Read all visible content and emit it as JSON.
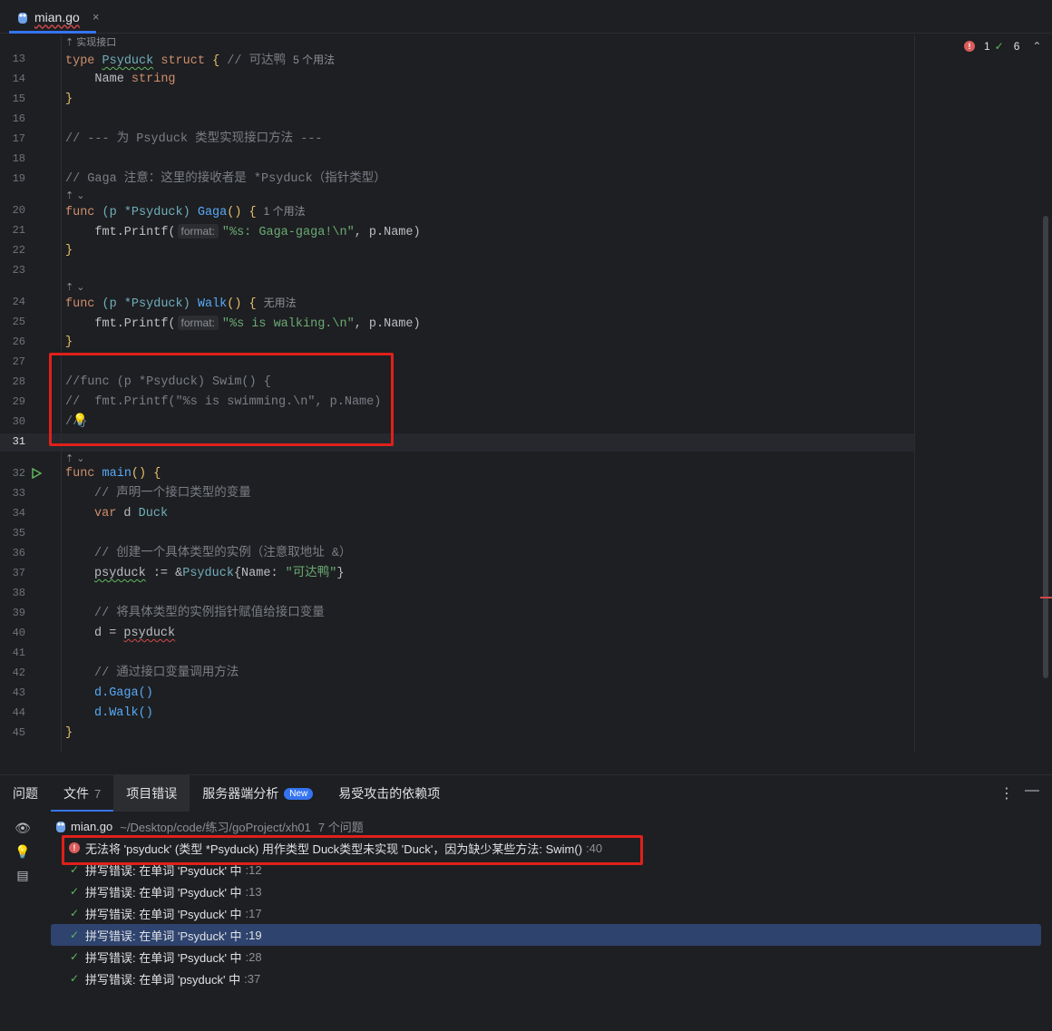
{
  "tab": {
    "filename": "mian.go",
    "close": "×"
  },
  "editor": {
    "status": {
      "errors": "1",
      "warnings": "6"
    },
    "annotations": {
      "implements": "实现接口"
    },
    "lines": [
      {
        "n": "13"
      },
      {
        "n": "14"
      },
      {
        "n": "15"
      },
      {
        "n": "16"
      },
      {
        "n": "17"
      },
      {
        "n": "18"
      },
      {
        "n": "19"
      },
      {
        "n": "20"
      },
      {
        "n": "21"
      },
      {
        "n": "22"
      },
      {
        "n": "23"
      },
      {
        "n": "24"
      },
      {
        "n": "25"
      },
      {
        "n": "26"
      },
      {
        "n": "27"
      },
      {
        "n": "28"
      },
      {
        "n": "29"
      },
      {
        "n": "30"
      },
      {
        "n": "31"
      },
      {
        "n": "32"
      },
      {
        "n": "33"
      },
      {
        "n": "34"
      },
      {
        "n": "35"
      },
      {
        "n": "36"
      },
      {
        "n": "37"
      },
      {
        "n": "38"
      },
      {
        "n": "39"
      },
      {
        "n": "40"
      },
      {
        "n": "41"
      },
      {
        "n": "42"
      },
      {
        "n": "43"
      },
      {
        "n": "44"
      },
      {
        "n": "45"
      }
    ],
    "code": {
      "l13_kw": "type",
      "l13_name": "Psyduck",
      "l13_kw2": "struct",
      "l13_brace": "{",
      "l13_cm": "// 可达鸭",
      "l13_hint": "5 个用法",
      "l14_field": "Name",
      "l14_type": "string",
      "l15": "}",
      "l17": "// --- 为 Psyduck 类型实现接口方法 ---",
      "l19": "// Gaga 注意：这里的接收者是 *Psyduck（指针类型）",
      "l20_a": "func",
      "l20_b": "(p *Psyduck)",
      "l20_fn": "Gaga",
      "l20_c": "() {",
      "l20_hint": "1 个用法",
      "l21_a": "fmt.Printf(",
      "l21_inlay": "format:",
      "l21_str": "\"%s: Gaga-gaga!\\n\"",
      "l21_b": ", p.Name)",
      "l22": "}",
      "l24_a": "func",
      "l24_b": "(p *Psyduck)",
      "l24_fn": "Walk",
      "l24_c": "() {",
      "l24_hint": "无用法",
      "l25_a": "fmt.Printf(",
      "l25_inlay": "format:",
      "l25_str": "\"%s is walking.\\n\"",
      "l25_b": ", p.Name)",
      "l26": "}",
      "l28": "//func (p *Psyduck) Swim() {",
      "l29": "//  fmt.Printf(\"%s is swimming.\\n\", p.Name)",
      "l30": "//}",
      "l32_a": "func",
      "l32_fn": "main",
      "l32_b": "() {",
      "l33": "// 声明一个接口类型的变量",
      "l34_a": "var",
      "l34_b": "d",
      "l34_c": "Duck",
      "l36": "// 创建一个具体类型的实例（注意取地址 &）",
      "l37_a": "psyduck",
      "l37_b": ":= &",
      "l37_c": "Psyduck",
      "l37_d": "{Name:",
      "l37_str": "\"可达鸭\"",
      "l37_e": "}",
      "l39": "// 将具体类型的实例指针赋值给接口变量",
      "l40_a": "d =",
      "l40_b": "psyduck",
      "l42": "// 通过接口变量调用方法",
      "l43": "d.Gaga()",
      "l44": "d.Walk()",
      "l45": "}"
    }
  },
  "panel": {
    "tabs": [
      {
        "label": "问题"
      },
      {
        "label": "文件",
        "count": "7"
      },
      {
        "label": "项目错误"
      },
      {
        "label": "服务器端分析",
        "badge": "New"
      },
      {
        "label": "易受攻击的依赖项"
      }
    ],
    "file": {
      "name": "mian.go",
      "path": "~/Desktop/code/练习/goProject/xh01",
      "count": "7 个问题"
    },
    "problems": [
      {
        "text": "无法将 'psyduck' (类型 *Psyduck) 用作类型 Duck类型未实现 'Duck'，因为缺少某些方法: Swim()",
        "line": ":40",
        "kind": "error"
      },
      {
        "text": "拼写错误: 在单词 'Psyduck' 中",
        "line": ":12",
        "kind": "typo"
      },
      {
        "text": "拼写错误: 在单词 'Psyduck' 中",
        "line": ":13",
        "kind": "typo"
      },
      {
        "text": "拼写错误: 在单词 'Psyduck' 中",
        "line": ":17",
        "kind": "typo"
      },
      {
        "text": "拼写错误: 在单词 'Psyduck' 中",
        "line": ":19",
        "kind": "typo"
      },
      {
        "text": "拼写错误: 在单词 'Psyduck' 中",
        "line": ":28",
        "kind": "typo"
      },
      {
        "text": "拼写错误: 在单词 'psyduck' 中",
        "line": ":37",
        "kind": "typo"
      }
    ]
  },
  "colors": {
    "accent": "#3574f0",
    "error": "#db5c5c",
    "highlight_box": "#e0201a"
  }
}
